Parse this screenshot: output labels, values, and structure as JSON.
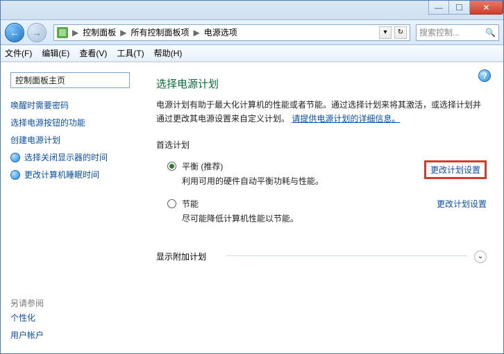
{
  "navbar": {
    "back_glyph": "←",
    "fwd_glyph": "→",
    "breadcrumbs": [
      "控制面板",
      "所有控制面板项",
      "电源选项"
    ],
    "sep": "▶",
    "dropdown_glyph": "▾",
    "refresh_glyph": "↻",
    "search_placeholder": "搜索控制...",
    "search_icon": "🔍"
  },
  "menubar": {
    "file": "文件(F)",
    "edit": "编辑(E)",
    "view": "查看(V)",
    "tools": "工具(T)",
    "help": "帮助(H)"
  },
  "sidebar": {
    "home": "控制面板主页",
    "links": [
      "唤醒时需要密码",
      "选择电源按钮的功能",
      "创建电源计划",
      "选择关闭显示器的时间",
      "更改计算机睡眠时间"
    ],
    "seealso_label": "另请参阅",
    "seealso_links": [
      "个性化",
      "用户帐户"
    ]
  },
  "content": {
    "help_glyph": "?",
    "heading": "选择电源计划",
    "para_part1": "电源计划有助于最大化计算机的性能或者节能。通过选择计划来将其激活，或选择计划并通过更改其电源设置来自定义计划。",
    "para_link": "请提供电源计划的详细信息。",
    "preferred_label": "首选计划",
    "plans": [
      {
        "title": "平衡 (推荐)",
        "desc": "利用可用的硬件自动平衡功耗与性能。",
        "change": "更改计划设置",
        "checked": true
      },
      {
        "title": "节能",
        "desc": "尽可能降低计算机性能以节能。",
        "change": "更改计划设置",
        "checked": false
      }
    ],
    "additional_label": "显示附加计划",
    "expand_glyph": "⌄"
  },
  "winbtns": {
    "min": "—",
    "max": "☐",
    "close": "✕"
  }
}
